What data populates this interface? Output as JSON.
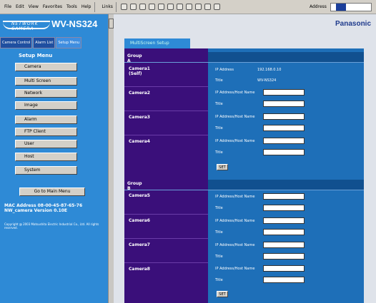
{
  "browser": {
    "menus": [
      "File",
      "Edit",
      "View",
      "Favorites",
      "Tools",
      "Help"
    ],
    "links_label": "Links",
    "address_label": "Address"
  },
  "header": {
    "logo_text": "NETWORK CAMERA",
    "model": "WV-NS324",
    "brand": "Panasonic"
  },
  "sidebar": {
    "tabs": [
      "Camera Control",
      "Alarm List",
      "Setup Menu"
    ],
    "menu_title": "Setup Menu",
    "items": [
      "Camera",
      "Multi Screen",
      "Network",
      "Image",
      "Alarm",
      "FTP Client",
      "User",
      "Host",
      "System"
    ],
    "main_menu_button": "Go to Main Menu",
    "mac_address": "MAC Address 08-00-45-87-65-76",
    "version": "NW_camera Version 0.10E",
    "copyright": "Copyright @ 2003 Matsushita Electric Industrial Co., Ltd. All rights reserved."
  },
  "main": {
    "page_tab": "MultiScreen Setup",
    "groups": [
      {
        "name": "Group A",
        "cameras": [
          {
            "label": "Camera1 (Self)",
            "ip_label": "IP Address",
            "ip_value": "192.168.0.10",
            "title_label": "Title",
            "title_value": "WV-NS324"
          },
          {
            "label": "Camera2",
            "ip_label": "IP Address/Host Name",
            "ip_value": "",
            "title_label": "Title",
            "title_value": ""
          },
          {
            "label": "Camera3",
            "ip_label": "IP Address/Host Name",
            "ip_value": "",
            "title_label": "Title",
            "title_value": ""
          },
          {
            "label": "Camera4",
            "ip_label": "IP Address/Host Name",
            "ip_value": "",
            "title_label": "Title",
            "title_value": ""
          }
        ],
        "set_label": "SET"
      },
      {
        "name": "Group B",
        "cameras": [
          {
            "label": "Camera5",
            "ip_label": "IP Address/Host Name",
            "ip_value": "",
            "title_label": "Title",
            "title_value": ""
          },
          {
            "label": "Camera6",
            "ip_label": "IP Address/Host Name",
            "ip_value": "",
            "title_label": "Title",
            "title_value": ""
          },
          {
            "label": "Camera7",
            "ip_label": "IP Address/Host Name",
            "ip_value": "",
            "title_label": "Title",
            "title_value": ""
          },
          {
            "label": "Camera8",
            "ip_label": "IP Address/Host Name",
            "ip_value": "",
            "title_label": "Title",
            "title_value": ""
          }
        ],
        "set_label": "SET"
      }
    ]
  }
}
